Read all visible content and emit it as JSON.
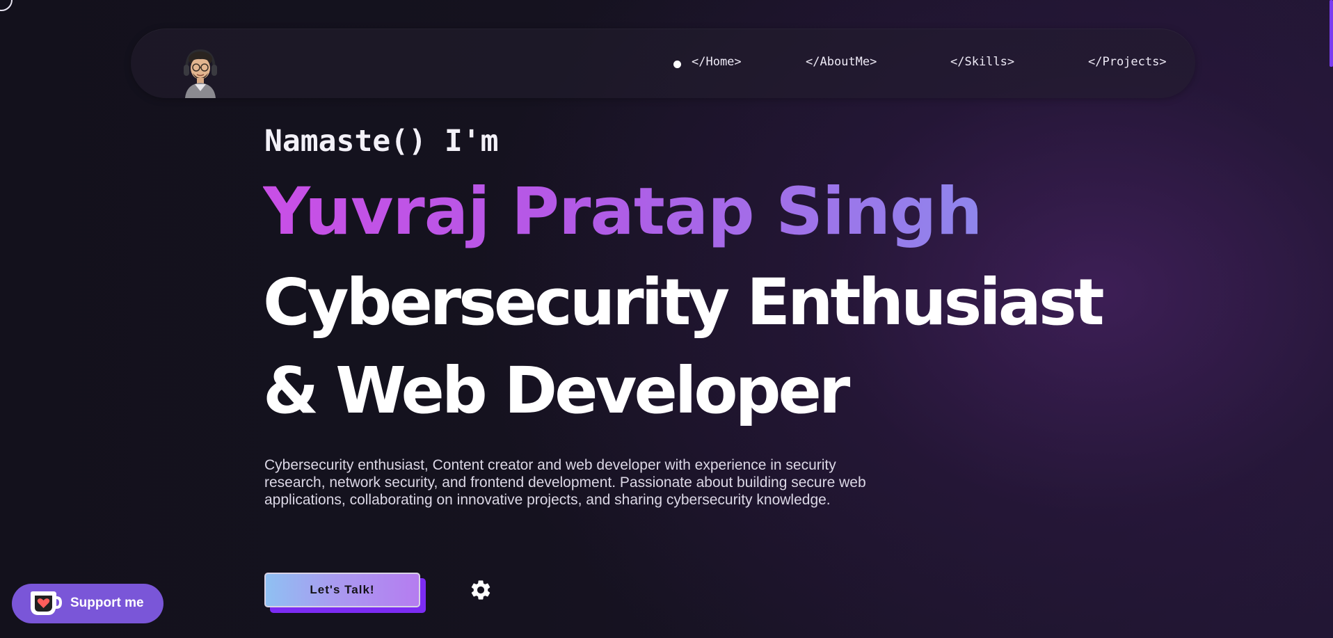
{
  "nav": {
    "items": [
      {
        "label": "</Home>",
        "active": true
      },
      {
        "label": "</AboutMe>",
        "active": false
      },
      {
        "label": "</Skills>",
        "active": false
      },
      {
        "label": "</Projects>",
        "active": false
      }
    ]
  },
  "hero": {
    "greeting": "Namaste() I'm",
    "name": "Yuvraj Pratap Singh",
    "role_line_1": "Cybersecurity Enthusiast",
    "role_line_2": "& Web Developer",
    "description": "Cybersecurity enthusiast, Content creator and web developer with experience in security research, network security, and frontend development. Passionate about building secure web applications, collaborating on innovative projects, and sharing cybersecurity knowledge.",
    "cta_label": "Let's Talk!"
  },
  "support": {
    "label": "Support me",
    "icon": "kofi-cup-heart-icon"
  },
  "icons": {
    "settings": "gear-icon",
    "avatar": "avatar"
  },
  "colors": {
    "background": "#13111c",
    "name_gradient_start": "#c94fe6",
    "name_gradient_end": "#8f86ec",
    "cta_gradient_start": "#8fc0f2",
    "cta_gradient_end": "#b57cf0",
    "cta_shadow": "#7c2cf3",
    "support_bg": "#7a56d8"
  }
}
